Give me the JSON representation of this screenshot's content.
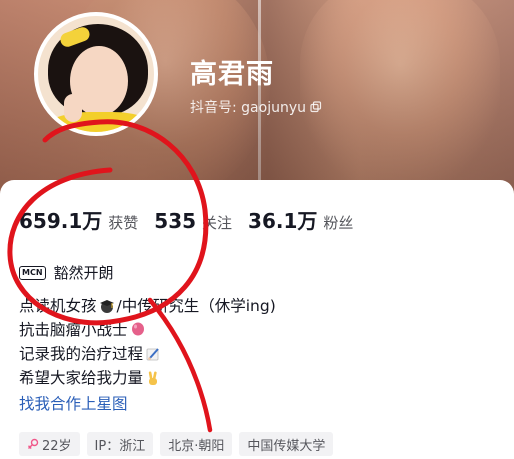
{
  "profile": {
    "name": "高君雨",
    "douyin_id": "抖音号: gaojunyu"
  },
  "stats": [
    {
      "value": "659.1万",
      "label": "获赞"
    },
    {
      "value": "535",
      "label": "关注"
    },
    {
      "value": "36.1万",
      "label": "粉丝"
    }
  ],
  "mcn": {
    "badge": "MCN",
    "text": "豁然开朗"
  },
  "bio": {
    "line1_a": "点读机女孩",
    "line1_b": "/中传研究生（休学ing)",
    "line2": "抗击脑瘤小战士",
    "line3": "记录我的治疗过程",
    "line4": "希望大家给我力量",
    "link": "找我合作上星图"
  },
  "tags": [
    {
      "text": "22岁",
      "icon": "female-icon"
    },
    {
      "text": "IP：浙江"
    },
    {
      "text": "北京·朝阳"
    },
    {
      "text": "中国传媒大学"
    }
  ],
  "colors": {
    "link": "#2b5fb8",
    "annotation": "#e0141c",
    "text": "#161823"
  }
}
